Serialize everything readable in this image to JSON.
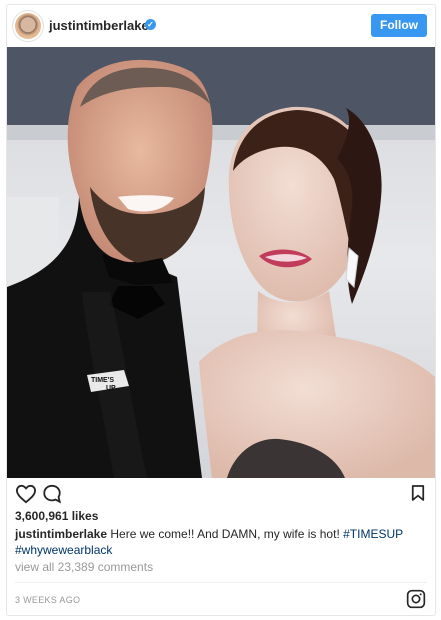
{
  "post": {
    "username": "justintimberlake",
    "verified_mark": "✓",
    "follow_label": "Follow",
    "likes": "3,600,961 likes",
    "caption": {
      "username": "justintimberlake",
      "text": " Here we come!! And DAMN, my wife is hot! ",
      "hashtag_1": "#TIMESUP",
      "hashtag_2": "#whywewearblack"
    },
    "view_comments": "view all 23,389 comments",
    "timestamp": "3 WEEKS AGO",
    "pin_text_1": "TIME'S",
    "pin_text_2": "UP"
  },
  "icons": {
    "avatar": "profile-avatar",
    "verified": "verified-badge-icon",
    "heart": "heart-icon",
    "comment": "comment-icon",
    "bookmark": "bookmark-icon",
    "instagram": "instagram-icon"
  },
  "colors": {
    "follow_button": "#3897f0",
    "hashtag": "#003569",
    "muted_text": "#999999"
  }
}
